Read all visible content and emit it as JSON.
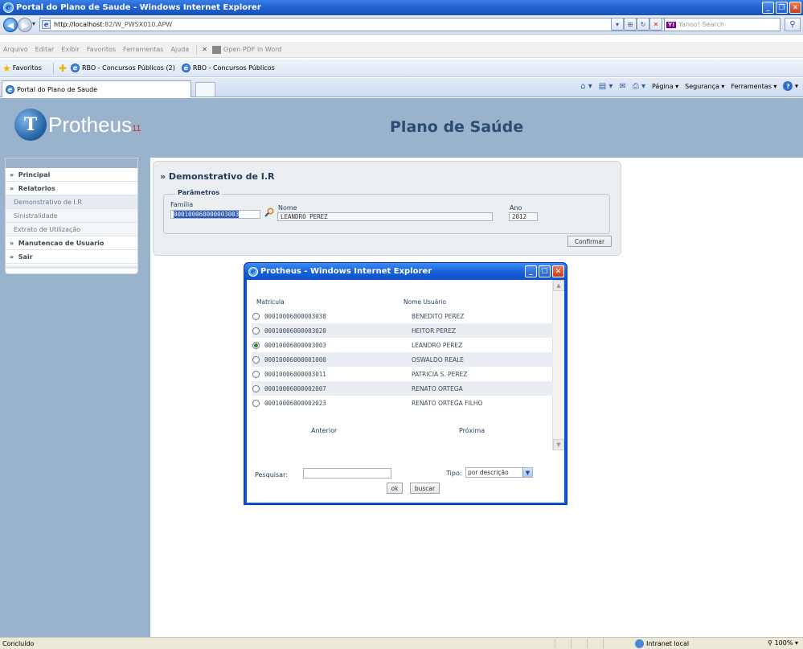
{
  "window": {
    "title": "Portal do Plano de Saude - Windows Internet Explorer"
  },
  "address": {
    "url_host": "http://localhost",
    "url_rest": ":82/W_PWSX010.APW",
    "search_placeholder": "Yahoo! Search",
    "search_brand": "Y!"
  },
  "menubar": {
    "items": [
      "Arquivo",
      "Editar",
      "Exibir",
      "Favoritos",
      "Ferramentas",
      "Ajuda"
    ],
    "pdf_label": "Open PDF in Word"
  },
  "favorites": {
    "label": "Favoritos",
    "items": [
      "RBO - Concursos Públicos (2)",
      "RBO - Concursos Públicos"
    ]
  },
  "tabs": {
    "active": "Portal do Plano de Saude"
  },
  "commandbar": {
    "page": "Página",
    "security": "Segurança",
    "tools": "Ferramentas"
  },
  "header": {
    "logo_text": "Protheus",
    "logo_sub": "11",
    "title": "Plano de Saúde"
  },
  "sidebar": {
    "items": [
      {
        "label": "Principal",
        "type": "head"
      },
      {
        "label": "Relatorios",
        "type": "head"
      },
      {
        "label": "Demonstrativo de I.R",
        "type": "sub"
      },
      {
        "label": "Sinistralidade",
        "type": "sub"
      },
      {
        "label": "Extrato de Utilização",
        "type": "sub"
      },
      {
        "label": "Manutencao de Usuario",
        "type": "head"
      },
      {
        "label": "Sair",
        "type": "head"
      }
    ]
  },
  "panel": {
    "title": "» Demonstrativo de I.R",
    "legend": "Parâmetros",
    "familia_label": "Família",
    "familia_value": "000100060000003003",
    "nome_label": "Nome",
    "nome_value": "LEANDRO PEREZ",
    "ano_label": "Ano",
    "ano_value": "2012",
    "confirm_label": "Confirmar"
  },
  "popup": {
    "title": "Protheus - Windows Internet Explorer",
    "col_matricula": "Matricula",
    "col_nome": "Nome Usuário",
    "rows": [
      {
        "matricula": "00010006000003038",
        "nome": "BENEDITO PEREZ",
        "selected": false
      },
      {
        "matricula": "00010006000003020",
        "nome": "HEITOR PEREZ",
        "selected": false
      },
      {
        "matricula": "00010006000003003",
        "nome": "LEANDRO PEREZ",
        "selected": true
      },
      {
        "matricula": "00010006000001000",
        "nome": "OSWALDO REALE",
        "selected": false
      },
      {
        "matricula": "00010006000003011",
        "nome": "PATRICIA S. PEREZ",
        "selected": false
      },
      {
        "matricula": "00010006000002007",
        "nome": "RENATO ORTEGA",
        "selected": false
      },
      {
        "matricula": "00010006000002023",
        "nome": "RENATO ORTEGA FILHO",
        "selected": false
      }
    ],
    "prev_label": "Anterior",
    "next_label": "Próxima",
    "search_label": "Pesquisar:",
    "tipo_label": "Tipo:",
    "tipo_value": "por descrição",
    "ok_label": "ok",
    "buscar_label": "buscar"
  },
  "status": {
    "text": "Concluído",
    "zone": "Intranet local",
    "zoom": "100%"
  }
}
